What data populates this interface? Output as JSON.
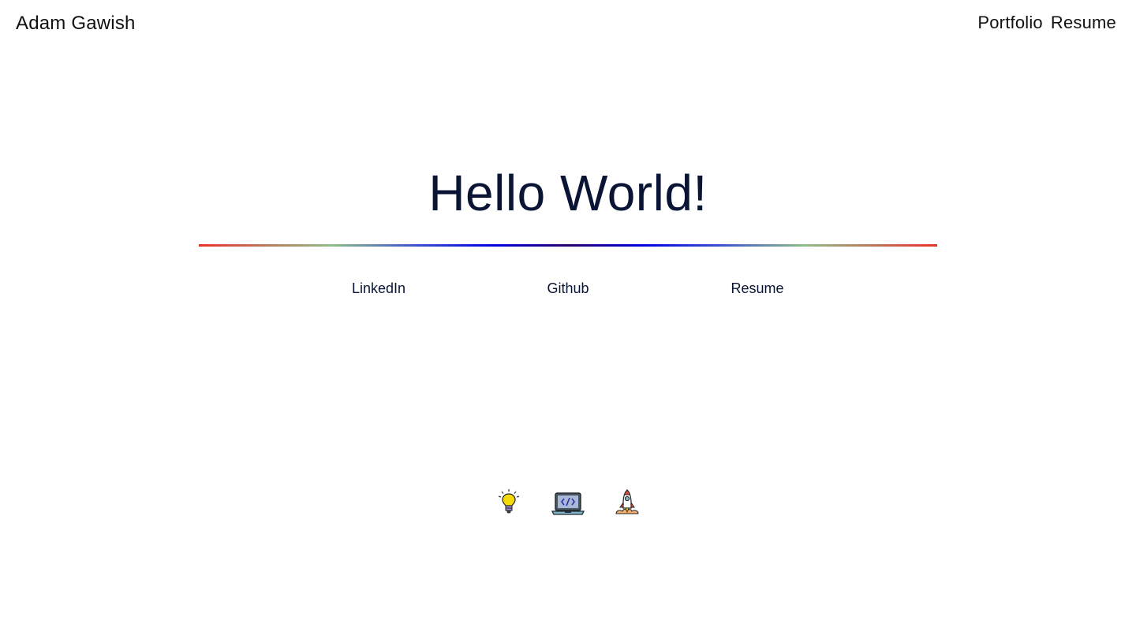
{
  "header": {
    "site_name": "Adam Gawish",
    "nav": {
      "portfolio": "Portfolio",
      "resume": "Resume"
    }
  },
  "hero": {
    "title": "Hello World!"
  },
  "links": {
    "linkedin": "LinkedIn",
    "github": "Github",
    "resume": "Resume"
  },
  "icons": [
    "lightbulb-icon",
    "laptop-code-icon",
    "rocket-icon"
  ],
  "colors": {
    "text_dark": "#0a1535",
    "divider_gradient": [
      "#e8332a",
      "#8fbf8a",
      "#0000e0",
      "#2a006a",
      "#0000e0",
      "#8fbf8a",
      "#e8332a"
    ]
  }
}
